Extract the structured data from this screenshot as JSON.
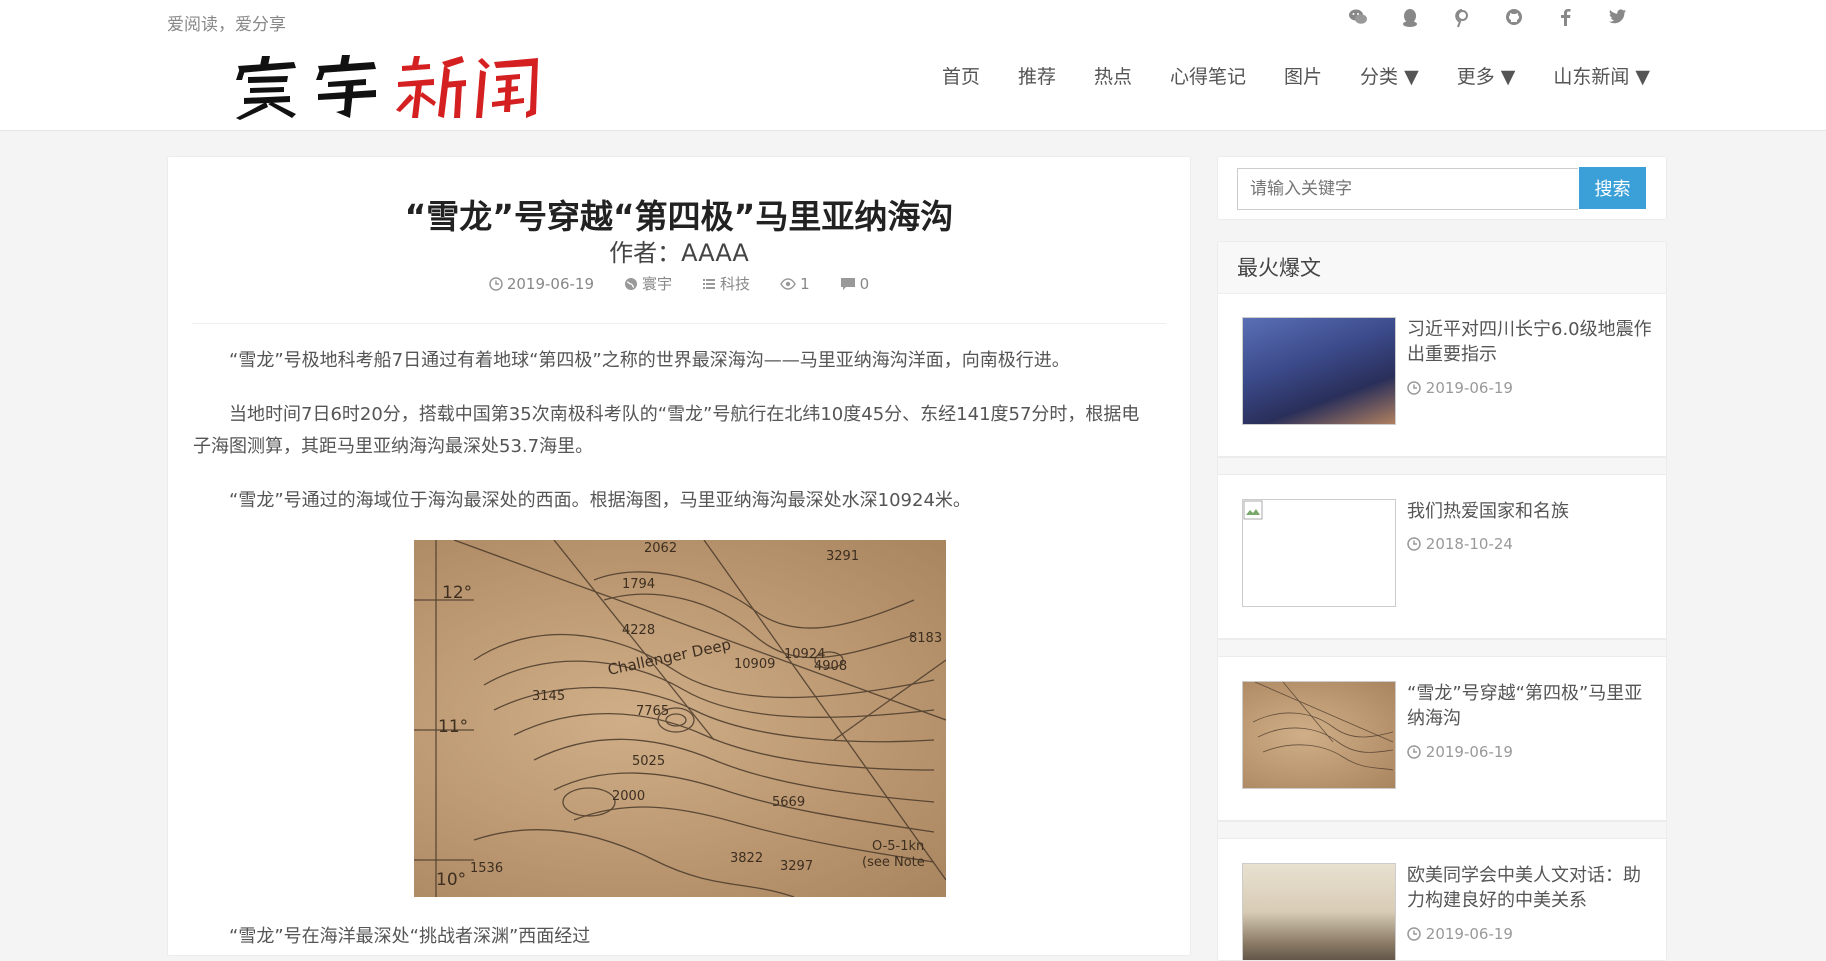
{
  "header": {
    "slogan": "爱阅读，爱分享",
    "logo_text": "寰宇新闻",
    "social_icons": [
      "wechat-icon",
      "qq-icon",
      "pinterest-icon",
      "github-icon",
      "facebook-icon",
      "twitter-icon"
    ],
    "nav": [
      "首页",
      "推荐",
      "热点",
      "心得笔记",
      "图片",
      "分类 ▼",
      "更多 ▼",
      "山东新闻 ▼"
    ]
  },
  "article": {
    "title": "“雪龙”号穿越“第四极”马里亚纳海沟",
    "author": "作者：AAAA",
    "meta": {
      "date": "2019-06-19",
      "source": "寰宇",
      "category": "科技",
      "views": "1",
      "comments": "0"
    },
    "paragraphs": [
      "“雪龙”号极地科考船7日通过有着地球“第四极”之称的世界最深海沟——马里亚纳海沟洋面，向南极行进。",
      "当地时间7日6时20分，搭载中国第35次南极科考队的“雪龙”号航行在北纬10度45分、东经141度57分时，根据电子海图测算，其距马里亚纳海沟最深处53.7海里。",
      "“雪龙”号通过的海域位于海沟最深处的西面。根据海图，马里亚纳海沟最深处水深10924米。",
      "“雪龙”号在海洋最深处“挑战者深渊”西面经过"
    ],
    "map_labels": [
      "12°",
      "11°",
      "10°",
      "Challenger Deep",
      "10909",
      "10924",
      "7765",
      "5025",
      "3145",
      "2062",
      "3291",
      "8183",
      "5669",
      "3822",
      "3297",
      "2000",
      "1536",
      "1794",
      "4228",
      "4908",
      "O-5-1kn",
      "(see Note"
    ]
  },
  "sidebar": {
    "search_placeholder": "请输入关键字",
    "search_button": "搜索",
    "hot_heading": "最火爆文",
    "hot_items": [
      {
        "title": "习近平对四川长宁6.0级地震作出重要指示",
        "date": "2019-06-19"
      },
      {
        "title": "我们热爱国家和名族",
        "date": "2018-10-24"
      },
      {
        "title": "“雪龙”号穿越“第四极”马里亚纳海沟",
        "date": "2019-06-19"
      },
      {
        "title": "欧美同学会中美人文对话：助力构建良好的中美关系",
        "date": "2019-06-19"
      }
    ]
  },
  "colors": {
    "accent": "#3ca0d8",
    "logo_black": "#111111",
    "logo_red": "#d42020"
  }
}
